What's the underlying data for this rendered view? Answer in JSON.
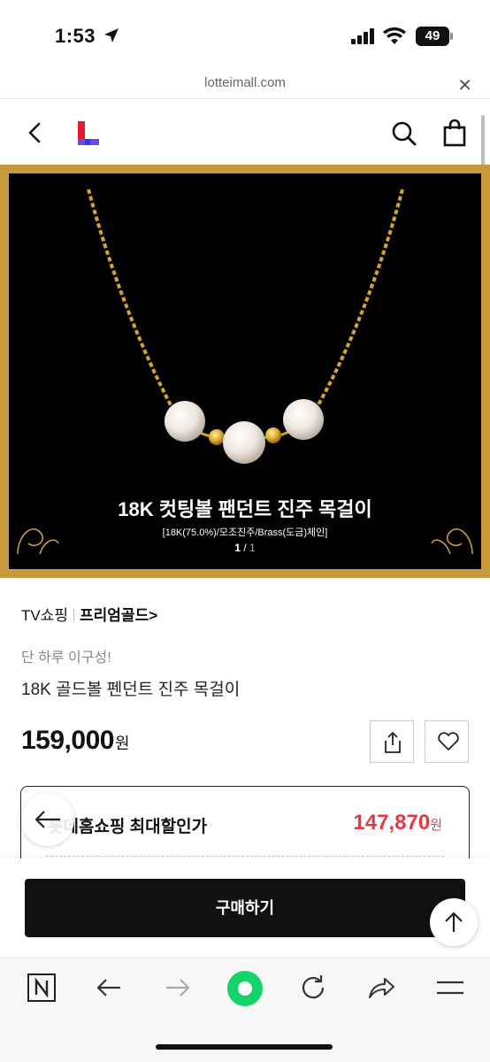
{
  "status_bar": {
    "time": "1:53",
    "battery": "49"
  },
  "browser": {
    "url": "lotteimall.com",
    "close_icon": "close-icon"
  },
  "header": {
    "back_icon": "chevron-left-icon",
    "logo": "lotte-l-logo",
    "search_icon": "search-icon",
    "cart_icon": "shopping-bag-icon"
  },
  "hero": {
    "title": "18K 컷팅볼 팬던트 진주 목걸이",
    "subtitle": "[18K(75.0%)/모조진주/Brass(도금)체인]",
    "pager_current": "1",
    "pager_separator": " / ",
    "pager_total": "1"
  },
  "product": {
    "channel": "TV쇼핑",
    "brand": "프리엄골드",
    "brand_chevron": ">",
    "promo": "단 하루 이구성!",
    "name": "18K 골드볼 펜던트 진주 목걸이",
    "price": "159,000",
    "currency": "원"
  },
  "deal": {
    "label": "롯데홈쇼핑 최대할인가",
    "amount": "147,870",
    "currency": "원",
    "accent_color": "#e63946"
  },
  "actions": {
    "buy_label": "구매하기",
    "share_icon": "share-icon",
    "wish_icon": "heart-icon",
    "top_icon": "arrow-up-icon"
  },
  "bottom_nav": {
    "items": [
      "naver-n-icon",
      "back-arrow-icon",
      "forward-arrow-icon",
      "green-dot-icon",
      "refresh-icon",
      "share-arrow-icon",
      "menu-icon"
    ]
  }
}
